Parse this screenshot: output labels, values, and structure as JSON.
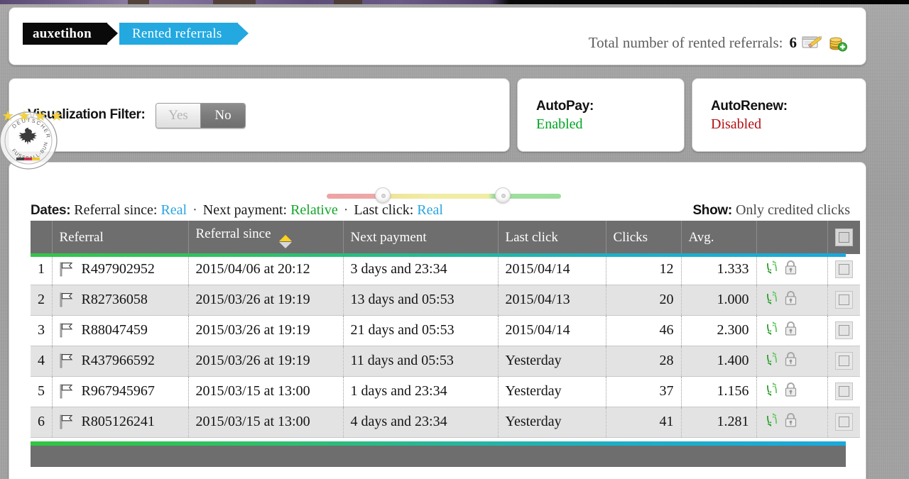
{
  "header": {
    "breadcrumb": [
      {
        "label": "auxetihon",
        "style": "black"
      },
      {
        "label": "Rented referrals",
        "style": "blue"
      }
    ],
    "total_label": "Total number of rented referrals:",
    "total_count": "6",
    "icons": [
      "notepad-pencil-icon",
      "add-coins-icon"
    ]
  },
  "filters": {
    "visualization_filter": {
      "label": "Visualization Filter:",
      "options": [
        "Yes",
        "No"
      ],
      "selected": "No"
    },
    "autopay": {
      "title": "AutoPay:",
      "value": "Enabled",
      "color": "#00a422"
    },
    "autorenew": {
      "title": "AutoRenew:",
      "value": "Disabled",
      "color": "#b40f12"
    }
  },
  "slider": {
    "segments": [
      "red",
      "yellow",
      "green"
    ],
    "handles": 2,
    "colors": {
      "red": "#eda3a3",
      "yellow": "#f0eda4",
      "green": "#9fdf9f"
    }
  },
  "dates_bar": {
    "label": "Dates:",
    "items": [
      {
        "name": "Referral since:",
        "value": "Real",
        "kind": "real"
      },
      {
        "name": "Next payment:",
        "value": "Relative",
        "kind": "relative"
      },
      {
        "name": "Last click:",
        "value": "Real",
        "kind": "real"
      }
    ],
    "separator": "·",
    "show_label": "Show:",
    "show_value": "Only credited clicks"
  },
  "table": {
    "columns": [
      "",
      "Referral",
      "Referral since",
      "Next payment",
      "Last click",
      "Clicks",
      "Avg.",
      "",
      ""
    ],
    "sort_column": "Referral since",
    "sort_direction": "asc",
    "select_all_checkbox": "unchecked",
    "rows": [
      {
        "index": "1",
        "flag": "flag-icon",
        "referral": "R497902952",
        "referral_since": "2015/04/06 at 20:12",
        "next_payment": "3 days and 23:34",
        "next_payment_warn": true,
        "last_click": "2015/04/14",
        "clicks": "12",
        "avg": "1.333",
        "recycle": "recycle-icon",
        "lock": "lock-icon",
        "checkbox": "unchecked"
      },
      {
        "index": "2",
        "flag": "flag-icon",
        "referral": "R82736058",
        "referral_since": "2015/03/26 at 19:19",
        "next_payment": "13 days and 05:53",
        "next_payment_warn": false,
        "last_click": "2015/04/13",
        "clicks": "20",
        "avg": "1.000",
        "recycle": "recycle-icon",
        "lock": "lock-icon",
        "checkbox": "unchecked"
      },
      {
        "index": "3",
        "flag": "flag-icon",
        "referral": "R88047459",
        "referral_since": "2015/03/26 at 19:19",
        "next_payment": "21 days and 05:53",
        "next_payment_warn": false,
        "last_click": "2015/04/14",
        "clicks": "46",
        "avg": "2.300",
        "recycle": "recycle-icon",
        "lock": "lock-icon",
        "checkbox": "unchecked"
      },
      {
        "index": "4",
        "flag": "flag-icon",
        "referral": "R437966592",
        "referral_since": "2015/03/26 at 19:19",
        "next_payment": "11 days and 05:53",
        "next_payment_warn": false,
        "last_click": "Yesterday",
        "clicks": "28",
        "avg": "1.400",
        "recycle": "recycle-icon",
        "lock": "lock-icon",
        "checkbox": "unchecked"
      },
      {
        "index": "5",
        "flag": "flag-icon",
        "referral": "R967945967",
        "referral_since": "2015/03/15 at 13:00",
        "next_payment": "1 days and 23:34",
        "next_payment_warn": true,
        "last_click": "Yesterday",
        "clicks": "37",
        "avg": "1.156",
        "recycle": "recycle-icon",
        "lock": "lock-icon",
        "checkbox": "unchecked"
      },
      {
        "index": "6",
        "flag": "flag-icon",
        "referral": "R805126241",
        "referral_since": "2015/03/15 at 13:00",
        "next_payment": "4 days and 23:34",
        "next_payment_warn": true,
        "last_click": "Yesterday",
        "clicks": "41",
        "avg": "1.281",
        "recycle": "recycle-icon",
        "lock": "lock-icon",
        "checkbox": "unchecked"
      }
    ]
  },
  "watermark": {
    "badge": "dfb-eagle-badge",
    "badge_text_top": "DEUTSCHER",
    "badge_text_bottom": "FUSSBALL-BUND",
    "stars": 4
  }
}
